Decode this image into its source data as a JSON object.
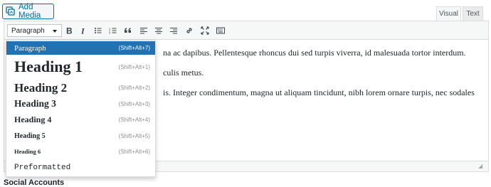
{
  "toolbar_top": {
    "add_media_label": "Add Media",
    "tabs": [
      "Visual",
      "Text"
    ]
  },
  "editor": {
    "format_select_value": "Paragraph",
    "buttons": [
      "bold-icon",
      "italic-icon",
      "bulleted-list-icon",
      "numbered-list-icon",
      "blockquote-icon",
      "align-left-icon",
      "align-center-icon",
      "align-right-icon",
      "link-icon",
      "fullscreen-icon",
      "toolbar-toggle-icon"
    ],
    "paragraphs": [
      "na ac dapibus. Pellentesque rhoncus dui sed turpis viverra, id malesuada tortor interdum.",
      "culis metus.",
      "is. Integer condimentum, magna ut aliquam tincidunt, nibh lorem ornare turpis, nec sodales"
    ]
  },
  "format_menu": {
    "items": [
      {
        "label": "Paragraph",
        "shortcut": "(Shift+Alt+7)"
      },
      {
        "label": "Heading 1",
        "shortcut": "(Shift+Alt+1)"
      },
      {
        "label": "Heading 2",
        "shortcut": "(Shift+Alt+2)"
      },
      {
        "label": "Heading 3",
        "shortcut": "(Shift+Alt+3)"
      },
      {
        "label": "Heading 4",
        "shortcut": "(Shift+Alt+4)"
      },
      {
        "label": "Heading 5",
        "shortcut": "(Shift+Alt+5)"
      },
      {
        "label": "Heading 6",
        "shortcut": "(Shift+Alt+6)"
      },
      {
        "label": "Preformatted",
        "shortcut": ""
      }
    ],
    "selected_index": 0
  },
  "below_label": "Social Accounts",
  "colors": {
    "accent": "#2271b1",
    "link": "#0071a1"
  }
}
